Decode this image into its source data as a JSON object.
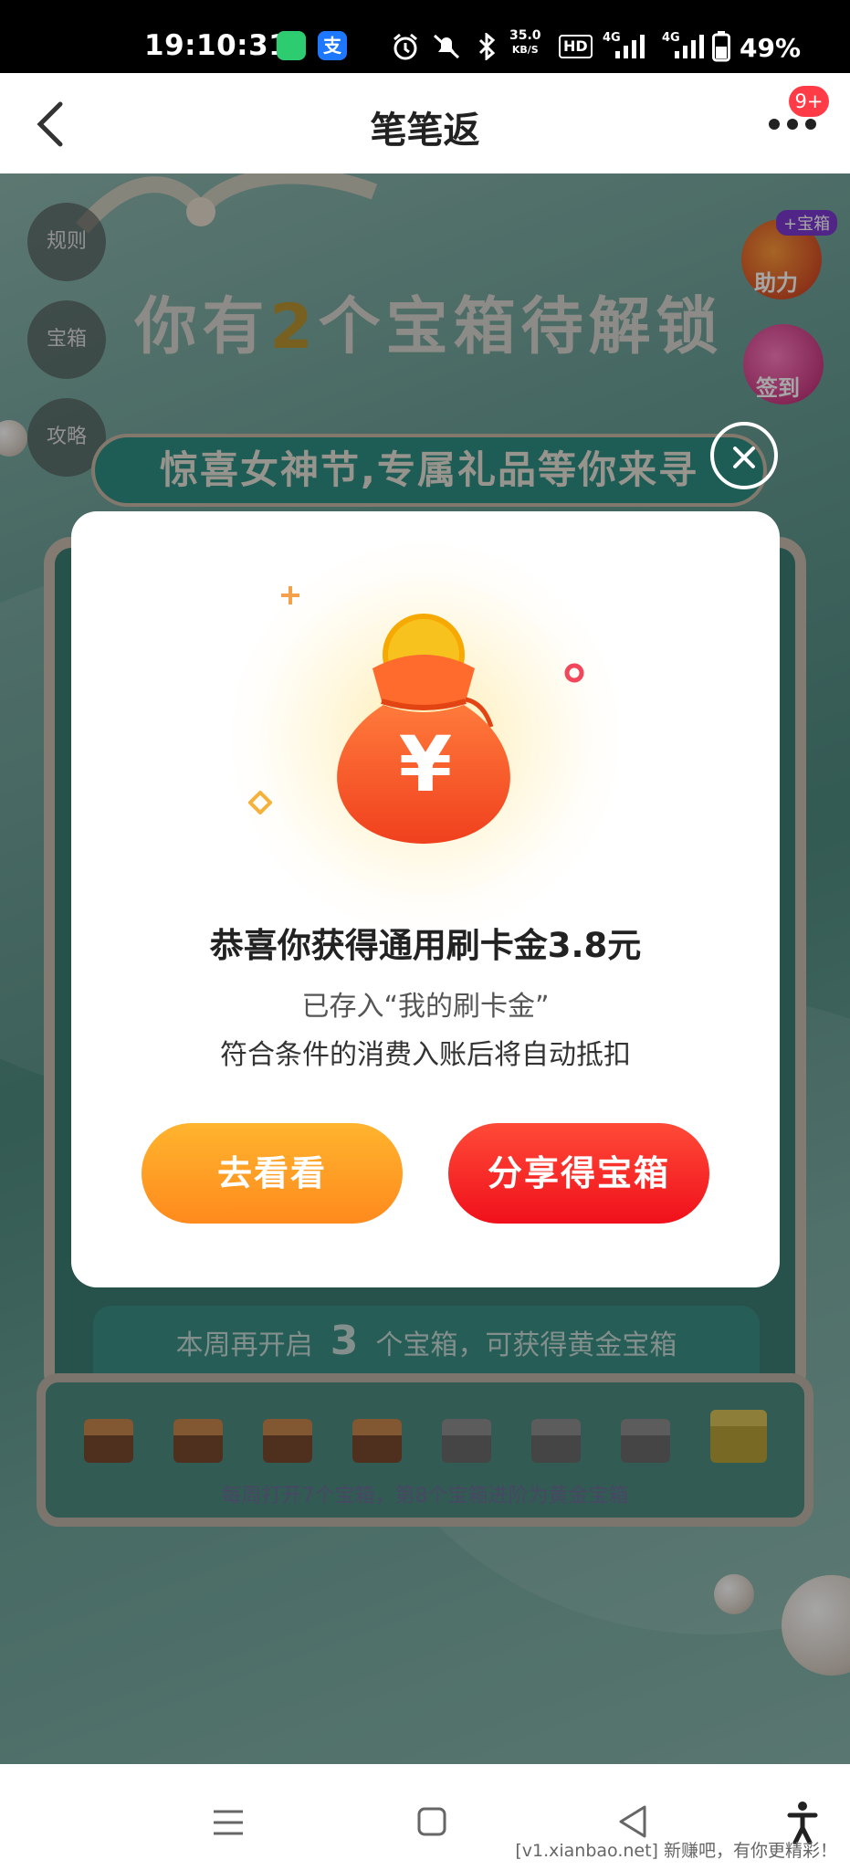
{
  "status_bar": {
    "time": "19:10:31",
    "speed_value": "35.0",
    "speed_unit": "KB/S",
    "hd_label": "HD",
    "network_1": "4G",
    "network_2": "4G",
    "battery": "49%"
  },
  "navbar": {
    "title": "笔笔返",
    "more_badge": "9+"
  },
  "background": {
    "side_buttons": [
      "规则",
      "宝箱",
      "攻略"
    ],
    "headline_prefix": "你有",
    "headline_number": "2",
    "headline_suffix": "个宝箱待解锁",
    "right_badge_top_tag": "+宝箱",
    "right_badge_top": "助力",
    "right_badge_bottom": "签到",
    "banner": "惊喜女神节,专属礼品等你来寻",
    "week_prefix": "本周再开启",
    "week_number": "3",
    "week_suffix": "个宝箱，可获得黄金宝箱",
    "chest_note": "每周打开7个宝箱，第8个宝箱进阶为黄金宝箱",
    "chests_opened": 4,
    "chests_total": 8
  },
  "dialog": {
    "yen_symbol": "¥",
    "title": "恭喜你获得通用刷卡金3.8元",
    "line1": "已存入“我的刷卡金”",
    "line2": "符合条件的消费入账后将自动抵扣",
    "button_look": "去看看",
    "button_share": "分享得宝箱"
  },
  "watermark": "[v1.xianbao.net] 新赚吧，有你更精彩！",
  "colors": {
    "accent_orange": "#ff9a22",
    "accent_red": "#f0101b",
    "teal": "#4f8a80"
  }
}
